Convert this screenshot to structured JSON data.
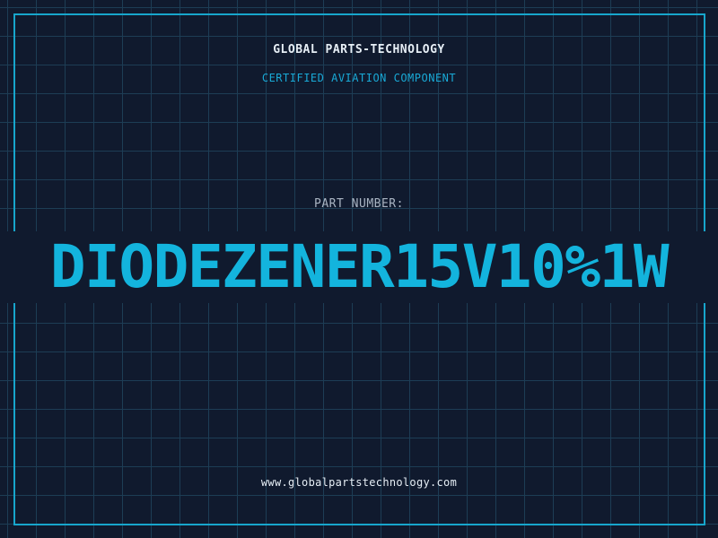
{
  "header": {
    "company": "GLOBAL PARTS-TECHNOLOGY",
    "tagline": "CERTIFIED AVIATION COMPONENT"
  },
  "part": {
    "label": "PART NUMBER:",
    "number": "DIODEZENER15V10%1W"
  },
  "footer": {
    "website": "www.globalpartstechnology.com"
  },
  "colors": {
    "background": "#101a2e",
    "grid": "#1d3d55",
    "accent": "#13b4dd",
    "text": "#e6eef5",
    "muted": "#a9b4c2"
  }
}
